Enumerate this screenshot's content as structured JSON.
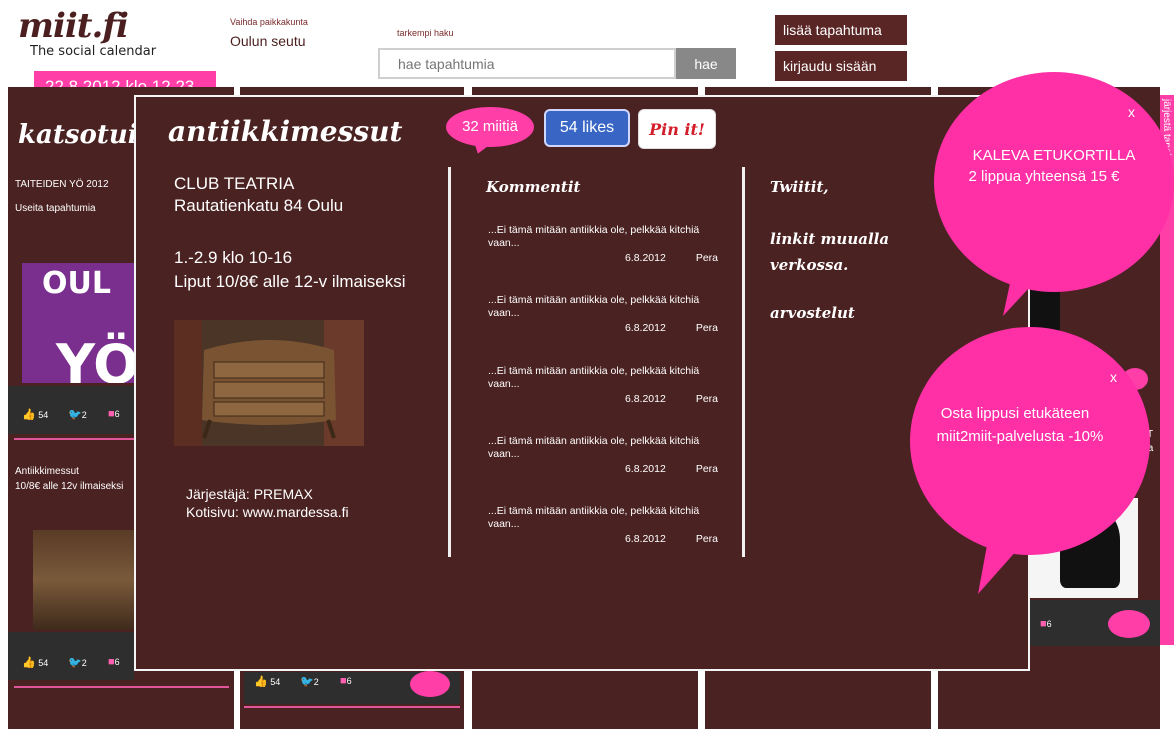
{
  "header": {
    "logo_name": "miit.fi",
    "logo_tagline": "The social calendar",
    "datetime": "22.8.2012 klo 12.23",
    "region_label": "Vaihda paikkakunta",
    "region_value": "Oulun seutu",
    "search_label": "tarkempi haku",
    "search_placeholder": "hae tapahtumia",
    "search_button": "hae",
    "add_event_button": "lisää tapahtuma",
    "login_button": "kirjaudu sisään"
  },
  "background": {
    "section_title": "katsotuin",
    "card1_title": "TAITEIDEN YÖ 2012",
    "card1_sub": "Useita tapahtumia",
    "card2_title": "Antiikkimessut",
    "card2_sub": "10/8€ alle 12v ilmaiseksi",
    "likes": "54",
    "tweets": "2",
    "comments": "6",
    "side_tab": "järjestä tapahtumat",
    "right_card_text1": "RT",
    "right_card_text2": "oja"
  },
  "modal": {
    "title": "antiikkimessut",
    "miit_count": "32 miitiä",
    "likes_button": "54 likes",
    "pin_button": "Pin it!",
    "venue": "CLUB TEATRIA",
    "address": "Rautatienkatu 84 Oulu",
    "time": "1.-2.9 klo 10-16",
    "tickets": "Liput 10/8€ alle 12-v ilmaiseksi",
    "organizer": "Järjestäjä: PREMAX",
    "homepage": "Kotisivu: www.mardessa.fi",
    "comments_heading": "Kommentit",
    "comments": [
      {
        "text": "...Ei tämä mitään antiikkia ole, pelkkää kitchiä vaan...",
        "date": "6.8.2012",
        "author": "Pera"
      },
      {
        "text": "...Ei tämä mitään antiikkia ole, pelkkää kitchiä vaan...",
        "date": "6.8.2012",
        "author": "Pera"
      },
      {
        "text": "...Ei tämä mitään antiikkia ole, pelkkää kitchiä vaan...",
        "date": "6.8.2012",
        "author": "Pera"
      },
      {
        "text": "...Ei tämä mitään antiikkia ole, pelkkää kitchiä vaan...",
        "date": "6.8.2012",
        "author": "Pera"
      },
      {
        "text": "...Ei tämä mitään antiikkia ole, pelkkää kitchiä vaan...",
        "date": "6.8.2012",
        "author": "Pera"
      }
    ],
    "tweets_heading": "Twiitit,",
    "links_heading_1": "linkit muualla",
    "links_heading_2": "verkossa.",
    "reviews_heading": "arvostelut"
  },
  "bubbles": {
    "offer1_close": "x",
    "offer1_line1": "KALEVA ETUKORTILLA",
    "offer1_line2": "2 lippua yhteensä 15 €",
    "offer2_close": "x",
    "offer2_line1": "Osta lippusi etukäteen",
    "offer2_line2": "miit2miit-palvelusta -10%"
  }
}
